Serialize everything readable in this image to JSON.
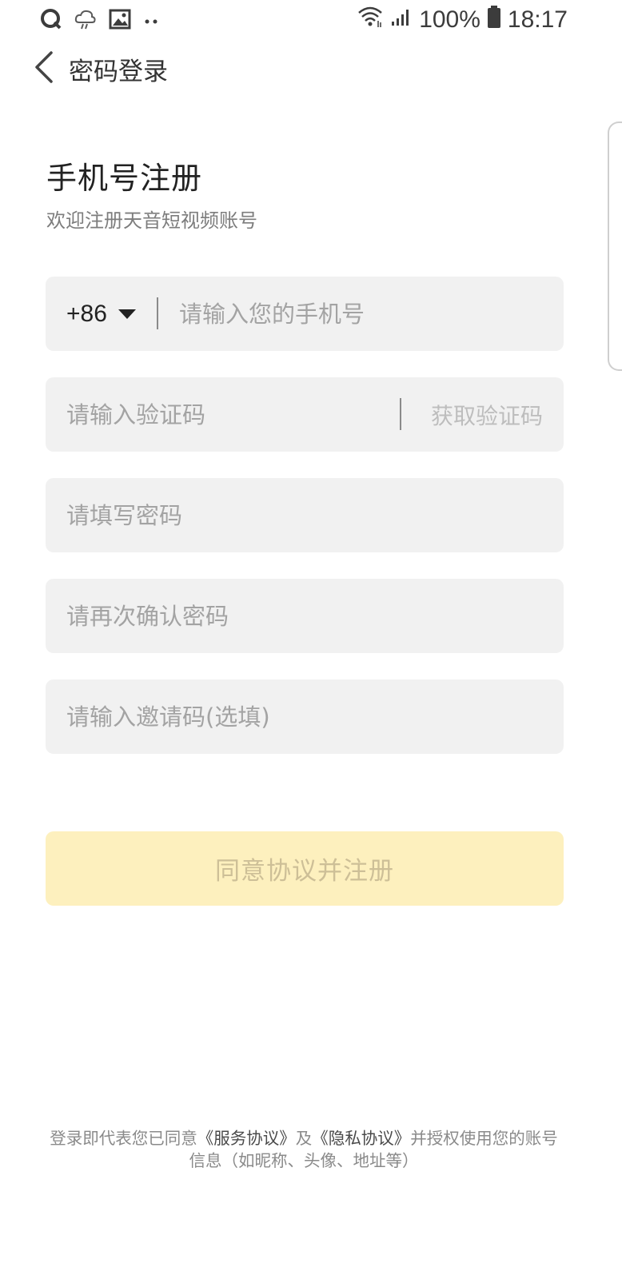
{
  "status_bar": {
    "battery": "100%",
    "time": "18:17",
    "left_icons": [
      "q-app-icon",
      "weather-cloud-icon",
      "image-icon",
      "more-dots-icon"
    ],
    "right_icons": [
      "wifi-icon",
      "signal-icon",
      "battery-icon"
    ]
  },
  "header": {
    "back_icon": "chevron-left-icon",
    "title": "密码登录"
  },
  "page": {
    "title": "手机号注册",
    "subtitle": "欢迎注册天音短视频账号"
  },
  "form": {
    "country_code": "+86",
    "phone_placeholder": "请输入您的手机号",
    "code_placeholder": "请输入验证码",
    "get_code_label": "获取验证码",
    "password_placeholder": "请填写密码",
    "confirm_placeholder": "请再次确认密码",
    "invite_placeholder": "请输入邀请码(选填)",
    "submit_label": "同意协议并注册"
  },
  "agreement": {
    "prefix": "登录即代表您已同意",
    "service_link": "《服务协议》",
    "and": "及",
    "privacy_link": "《隐私协议》",
    "suffix": "并授权使用您的账号信息（如昵称、头像、地址等）"
  },
  "colors": {
    "accent_disabled_bg": "#fdf0be",
    "field_bg": "#f1f1f1",
    "placeholder": "#a3a3a3"
  }
}
